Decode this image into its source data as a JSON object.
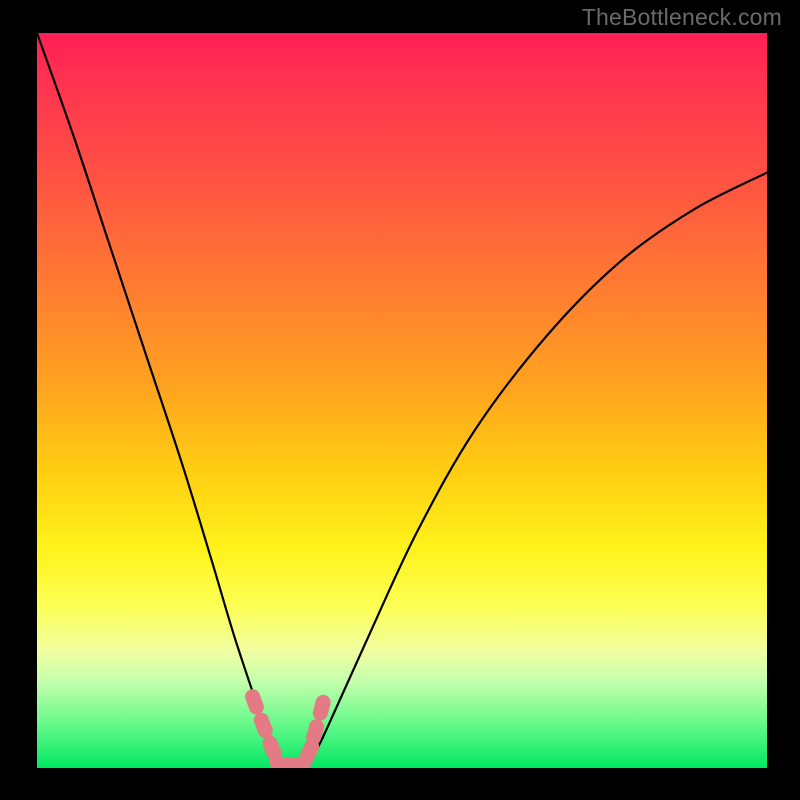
{
  "watermark": "TheBottleneck.com",
  "chart_data": {
    "type": "line",
    "title": "",
    "xlabel": "",
    "ylabel": "",
    "note": "Bottleneck curve. Axes unlabeled in image; x/y are fractions of the plot area (0–1, y=0 at bottom). Minimum near x≈0.34.",
    "xlim": [
      0,
      1
    ],
    "ylim": [
      0,
      1
    ],
    "series": [
      {
        "name": "bottleneck-curve",
        "x": [
          0.0,
          0.05,
          0.1,
          0.15,
          0.2,
          0.24,
          0.27,
          0.3,
          0.32,
          0.34,
          0.36,
          0.38,
          0.4,
          0.45,
          0.52,
          0.6,
          0.7,
          0.8,
          0.9,
          1.0
        ],
        "y": [
          1.0,
          0.86,
          0.71,
          0.56,
          0.41,
          0.28,
          0.18,
          0.09,
          0.03,
          0.0,
          0.0,
          0.02,
          0.06,
          0.17,
          0.32,
          0.46,
          0.59,
          0.69,
          0.76,
          0.81
        ]
      }
    ],
    "highlight": {
      "name": "near-minimum-marker",
      "color": "#e47a83",
      "x": [
        0.298,
        0.31,
        0.322,
        0.333,
        0.345,
        0.36,
        0.373,
        0.381,
        0.39
      ],
      "y": [
        0.09,
        0.058,
        0.027,
        0.004,
        0.004,
        0.004,
        0.022,
        0.049,
        0.082
      ]
    },
    "background_gradient": {
      "top": "#ff1f55",
      "mid": "#fff21a",
      "bottom": "#00e763"
    }
  }
}
